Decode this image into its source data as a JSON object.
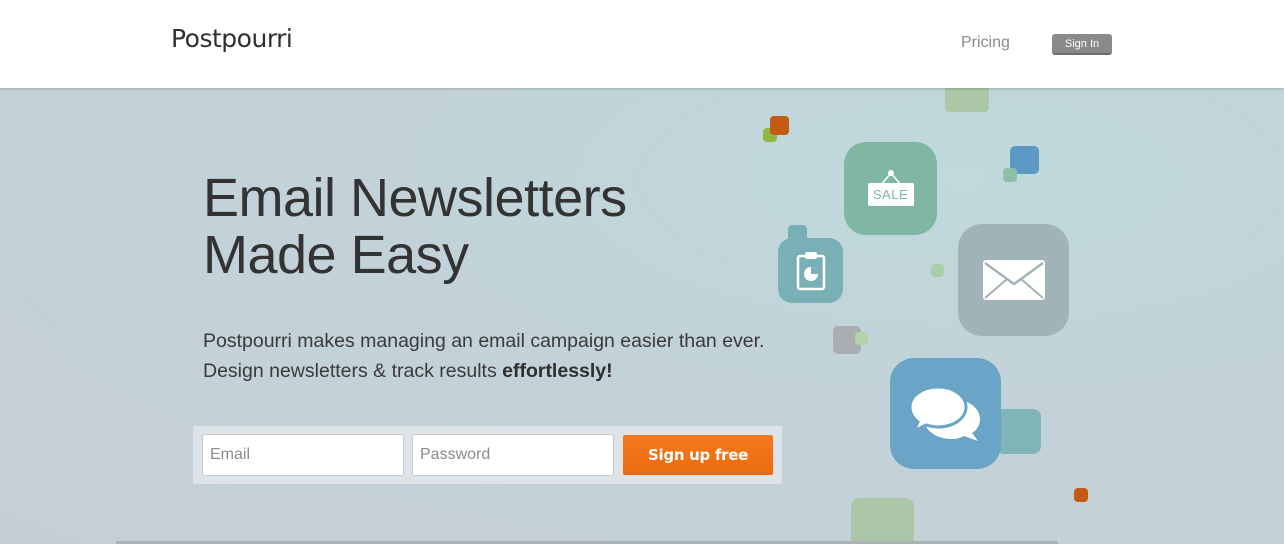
{
  "header": {
    "logo": "Postpourri",
    "nav_pricing": "Pricing",
    "signin_label": "Sign In"
  },
  "hero": {
    "headline_line1": "Email Newsletters",
    "headline_line2": "Made Easy",
    "subtext_line1": "Postpourri makes managing an email campaign easier than ever.",
    "subtext_line2_prefix": "Design newsletters & track results ",
    "subtext_line2_bold": "effortlessly!"
  },
  "signup_form": {
    "email_placeholder": "Email",
    "password_placeholder": "Password",
    "submit_label": "Sign up free"
  },
  "illustration": {
    "sale_tag_text": "SALE",
    "icons": [
      "sale-tag-icon",
      "clipboard-chart-icon",
      "envelope-icon",
      "speech-bubbles-icon"
    ]
  },
  "colors": {
    "accent_orange": "#f47216",
    "sale_tile": "#7fb7a3",
    "clipboard_tile": "#79b0b5",
    "envelope_tile": "#a2b3b8",
    "chat_tile": "#6aa4c7"
  }
}
